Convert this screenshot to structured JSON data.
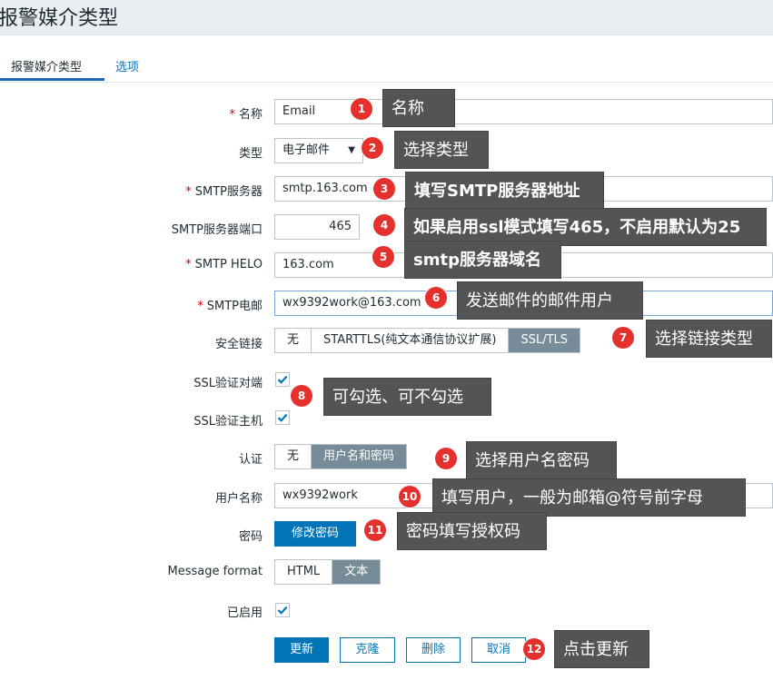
{
  "page": {
    "title": "报警媒介类型"
  },
  "tabs": [
    {
      "label": "报警媒介类型"
    },
    {
      "label": "选项"
    }
  ],
  "form": {
    "name": {
      "label": "名称",
      "value": "Email"
    },
    "type": {
      "label": "类型",
      "value": "电子邮件"
    },
    "smtp_server": {
      "label": "SMTP服务器",
      "value": "smtp.163.com"
    },
    "smtp_port": {
      "label": "SMTP服务器端口",
      "value": "465"
    },
    "smtp_helo": {
      "label": "SMTP HELO",
      "value": "163.com"
    },
    "smtp_email": {
      "label": "SMTP电邮",
      "value": "wx9392work@163.com"
    },
    "security": {
      "label": "安全链接",
      "options": [
        "无",
        "STARTTLS(纯文本通信协议扩展)",
        "SSL/TLS"
      ],
      "selected": "SSL/TLS"
    },
    "ssl_verify_peer": {
      "label": "SSL验证对端",
      "checked": true
    },
    "ssl_verify_host": {
      "label": "SSL验证主机",
      "checked": true
    },
    "auth": {
      "label": "认证",
      "options": [
        "无",
        "用户名和密码"
      ],
      "selected": "用户名和密码"
    },
    "username": {
      "label": "用户名称",
      "value": "wx9392work"
    },
    "password": {
      "label": "密码",
      "button": "修改密码"
    },
    "message_format": {
      "label": "Message format",
      "options": [
        "HTML",
        "文本"
      ],
      "selected": "文本"
    },
    "enabled": {
      "label": "已启用",
      "checked": true
    }
  },
  "actions": {
    "update": "更新",
    "clone": "克隆",
    "delete": "删除",
    "cancel": "取消"
  },
  "annotations": [
    {
      "num": "1",
      "text": "名称"
    },
    {
      "num": "2",
      "text": "选择类型"
    },
    {
      "num": "3",
      "text": "填写SMTP服务器地址"
    },
    {
      "num": "4",
      "text": "如果启用ssl模式填写465，不启用默认为25"
    },
    {
      "num": "5",
      "text": "smtp服务器域名"
    },
    {
      "num": "6",
      "text": "发送邮件的邮件用户"
    },
    {
      "num": "7",
      "text": "选择链接类型"
    },
    {
      "num": "8",
      "text": "可勾选、可不勾选"
    },
    {
      "num": "9",
      "text": "选择用户名密码"
    },
    {
      "num": "10",
      "text": "填写用户，一般为邮箱@符号前字母"
    },
    {
      "num": "11",
      "text": "密码填写授权码"
    },
    {
      "num": "12",
      "text": "点击更新"
    }
  ],
  "colors": {
    "primary": "#0275b8",
    "segment_selected": "#768d99",
    "badge": "#e5312e",
    "tooltip": "#545454",
    "required": "#d40000"
  }
}
